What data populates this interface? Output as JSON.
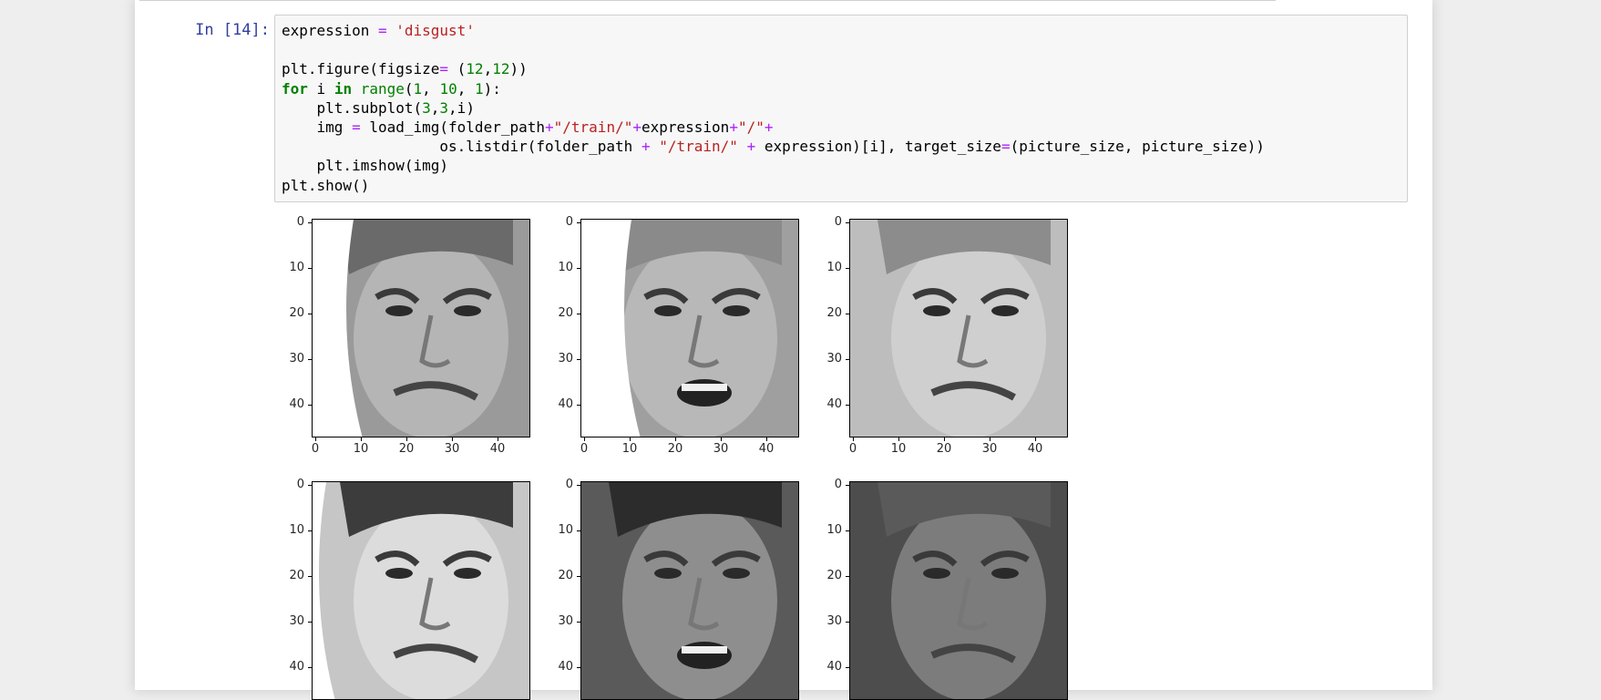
{
  "cell": {
    "prompt": "In [14]:",
    "code_lines": [
      [
        [
          "plain",
          "expression "
        ],
        [
          "op",
          "="
        ],
        [
          "plain",
          " "
        ],
        [
          "str",
          "'disgust'"
        ]
      ],
      [],
      [
        [
          "plain",
          "plt.figure(figsize"
        ],
        [
          "op",
          "="
        ],
        [
          "plain",
          " ("
        ],
        [
          "num",
          "12"
        ],
        [
          "plain",
          ","
        ],
        [
          "num",
          "12"
        ],
        [
          "plain",
          "))"
        ]
      ],
      [
        [
          "kw",
          "for"
        ],
        [
          "plain",
          " i "
        ],
        [
          "kw",
          "in"
        ],
        [
          "plain",
          " "
        ],
        [
          "bi",
          "range"
        ],
        [
          "plain",
          "("
        ],
        [
          "num",
          "1"
        ],
        [
          "plain",
          ", "
        ],
        [
          "num",
          "10"
        ],
        [
          "plain",
          ", "
        ],
        [
          "num",
          "1"
        ],
        [
          "plain",
          "):"
        ]
      ],
      [
        [
          "plain",
          "    plt.subplot("
        ],
        [
          "num",
          "3"
        ],
        [
          "plain",
          ","
        ],
        [
          "num",
          "3"
        ],
        [
          "plain",
          ",i)"
        ]
      ],
      [
        [
          "plain",
          "    img "
        ],
        [
          "op",
          "="
        ],
        [
          "plain",
          " load_img(folder_path"
        ],
        [
          "op",
          "+"
        ],
        [
          "str",
          "\"/train/\""
        ],
        [
          "op",
          "+"
        ],
        [
          "plain",
          "expression"
        ],
        [
          "op",
          "+"
        ],
        [
          "str",
          "\"/\""
        ],
        [
          "op",
          "+"
        ]
      ],
      [
        [
          "plain",
          "                  os.listdir(folder_path "
        ],
        [
          "op",
          "+"
        ],
        [
          "plain",
          " "
        ],
        [
          "str",
          "\"/train/\""
        ],
        [
          "plain",
          " "
        ],
        [
          "op",
          "+"
        ],
        [
          "plain",
          " expression)[i], target_size"
        ],
        [
          "op",
          "="
        ],
        [
          "plain",
          "(picture_size, picture_size))"
        ]
      ],
      [
        [
          "plain",
          "    plt.imshow(img)"
        ]
      ],
      [
        [
          "plain",
          "plt.show()"
        ]
      ]
    ]
  },
  "figure": {
    "yticks": [
      "0",
      "10",
      "20",
      "30",
      "40"
    ],
    "xticks": [
      "0",
      "10",
      "20",
      "30",
      "40"
    ],
    "subplots": [
      {
        "name": "subplot-1",
        "show_xticks": true
      },
      {
        "name": "subplot-2",
        "show_xticks": true
      },
      {
        "name": "subplot-3",
        "show_xticks": true
      },
      {
        "name": "subplot-4",
        "show_xticks": false
      },
      {
        "name": "subplot-5",
        "show_xticks": false
      },
      {
        "name": "subplot-6",
        "show_xticks": false
      }
    ]
  }
}
